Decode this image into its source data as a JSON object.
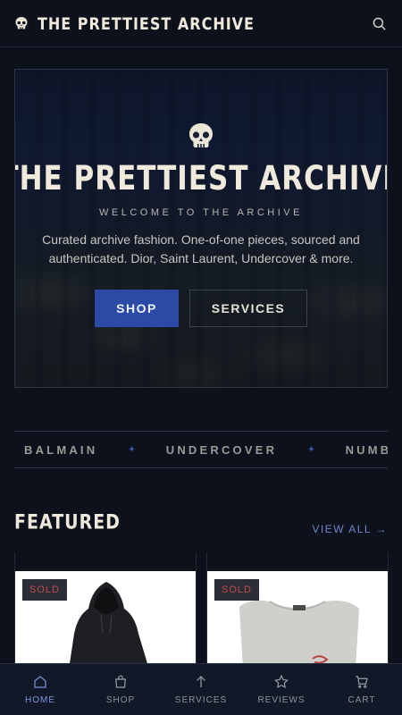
{
  "header": {
    "brand": "THE PRETTIEST ARCHIVE"
  },
  "hero": {
    "title": "THE PRETTIEST ARCHIVE",
    "subtitle": "WELCOME TO THE ARCHIVE",
    "description": "Curated archive fashion. One-of-one pieces, sourced and authenticated. Dior, Saint Laurent, Undercover & more.",
    "shop_label": "SHOP",
    "services_label": "SERVICES"
  },
  "ticker": {
    "brands": [
      "BALMAIN",
      "UNDERCOVER",
      "NUMB"
    ],
    "separator": "✦"
  },
  "featured": {
    "title": "FEATURED",
    "view_all": "VIEW ALL →",
    "products": [
      {
        "badge": "SOLD",
        "image": "black-hoodie"
      },
      {
        "badge": "SOLD",
        "image": "white-sleeveless-tank"
      }
    ]
  },
  "bottom_nav": {
    "items": [
      {
        "label": "HOME",
        "icon": "home-icon",
        "active": true
      },
      {
        "label": "SHOP",
        "icon": "bag-icon",
        "active": false
      },
      {
        "label": "SERVICES",
        "icon": "arrow-up-icon",
        "active": false
      },
      {
        "label": "REVIEWS",
        "icon": "star-icon",
        "active": false
      },
      {
        "label": "CART",
        "icon": "cart-icon",
        "active": false
      }
    ]
  },
  "colors": {
    "background": "#0c111b",
    "accent": "#2a4aa6",
    "sold": "#c24a4a",
    "text": "#efe9dc"
  }
}
